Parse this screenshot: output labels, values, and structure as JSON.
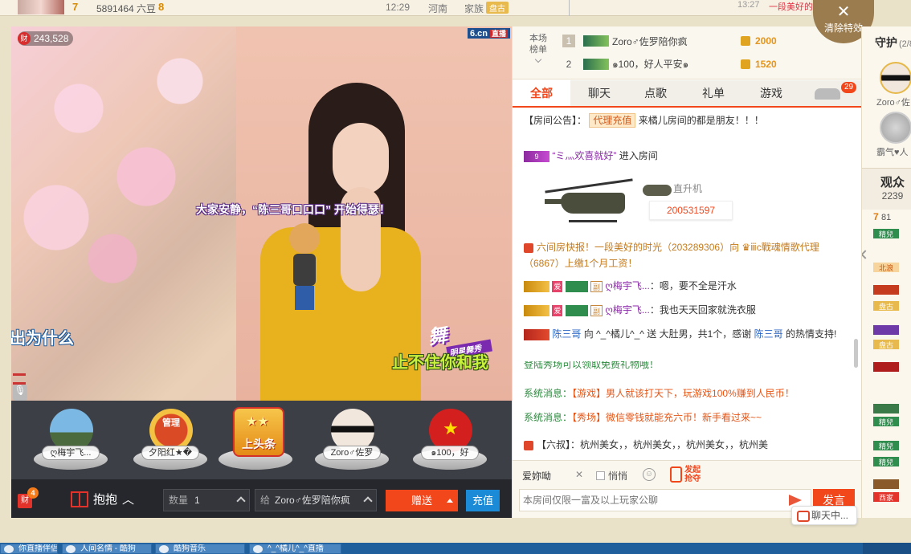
{
  "topbar": {
    "level": "7",
    "user_id": "5891464 六豆",
    "bean_level": "8",
    "time": "12:29",
    "location": "河南",
    "family_label": "家族",
    "family_badge": "盘古",
    "right_time": "13:27",
    "right_text": "一段美好的时光..."
  },
  "clear_effects": "清除特效",
  "video": {
    "viewer_count": "243,528",
    "viewer_icon": "财",
    "site_logo": "6.cn",
    "site_logo_tag": "直播",
    "announcement": "大家安静，“陈三哥口口口” 开始得瑟！",
    "lyric_left": "出为什么",
    "lyric_right": "止不住你和我",
    "dance_logo": "舞",
    "dance_logo_sub": "明星舞秀"
  },
  "guests": [
    {
      "name": "ღ梅宇飞..."
    },
    {
      "name": "夕阳红★�",
      "pic_text": "管理"
    },
    {
      "headline": "上头条"
    },
    {
      "name": "Zoro♂佐罗"
    },
    {
      "name": "๑100，好"
    }
  ],
  "controls": {
    "gift_badge": "4",
    "gift_icon": "财",
    "hug_label": "抱抱",
    "qty_label": "数量",
    "qty_value": "1",
    "to_label": "给",
    "to_value": "Zoro♂佐罗陪你疯",
    "send_label": "赠送",
    "recharge_label": "充值"
  },
  "rank": {
    "label": "本场榜单",
    "rows": [
      {
        "no": "1",
        "name": "Zoro♂佐罗陪你疯",
        "score": "2000"
      },
      {
        "no": "2",
        "name": "๑100，好人平安๑",
        "score": "1520"
      }
    ]
  },
  "tabs": [
    {
      "label": "全部"
    },
    {
      "label": "聊天"
    },
    {
      "label": "点歌"
    },
    {
      "label": "礼单"
    },
    {
      "label": "游戏"
    }
  ],
  "car_badge": "29",
  "chat": {
    "notice_prefix": "【房间公告】：",
    "notice_badge": "代理充值",
    "notice_text": "来橘儿房间的都是朋友！！！",
    "enter_vip": "9",
    "enter_user": "“ミ灬欢喜就好”",
    "enter_text": "进入房间",
    "heli_label": "直升机",
    "heli_id": "200531597",
    "news": "六间房快报！一段美好的时光（203289306）向 ♛ⅲc戰魂情歌代理（6867）上缴1个月工资！",
    "msg1_user": "ღ梅宇飞...",
    "msg1_text": "：嗯，要不全是汗水",
    "msg2_user": "ღ梅宇飞...",
    "msg2_text": "：我也天天回家就洗衣服",
    "msg3_from": "陈三哥",
    "msg3_to": "向 ^_^橘儿^_^ 送",
    "msg3_gift": "大肚男，共1个，感谢",
    "msg3_thank": "陈三哥",
    "msg3_end": "的热情支持!",
    "cut_line": "登陆秀场可以领取免费礼物哦！",
    "sys1_label": "系统消息：",
    "sys1_text": "【游戏】男人就该打天下，玩游戏100%赚到人民币！",
    "sys2_label": "系统消息：",
    "sys2_text": "【秀场】微信零钱就能充六币！新手看过来~~",
    "broadcast": "【六叔】：杭州美女，，杭州美女，，杭州美女，，杭州美"
  },
  "input": {
    "target": "爱妳呦",
    "close": "✕",
    "quiet_label": "悄悄",
    "smile": "☺",
    "redpack": "发起 抢夺",
    "placeholder": "本房间仅限一富及以上玩家公聊",
    "post_label": "发言"
  },
  "chatting_label": "聊天中...",
  "guard": {
    "title": "守护",
    "count": "(2/8",
    "guard1": "Zoro♂佐",
    "guard2": "霸气♥人",
    "audience_title": "观众",
    "audience_count": "2239",
    "row_level": "7",
    "row_text": "81",
    "tags": [
      "精兒",
      "北浪",
      "盘古",
      "盘古",
      "精兒",
      "精兒",
      "精兒",
      "西家"
    ]
  },
  "taskbar": {
    "items": [
      "你直播伴侣",
      "人间名情 - 酷狗",
      "酷狗音乐",
      "^_^橘儿^_^直播"
    ]
  }
}
